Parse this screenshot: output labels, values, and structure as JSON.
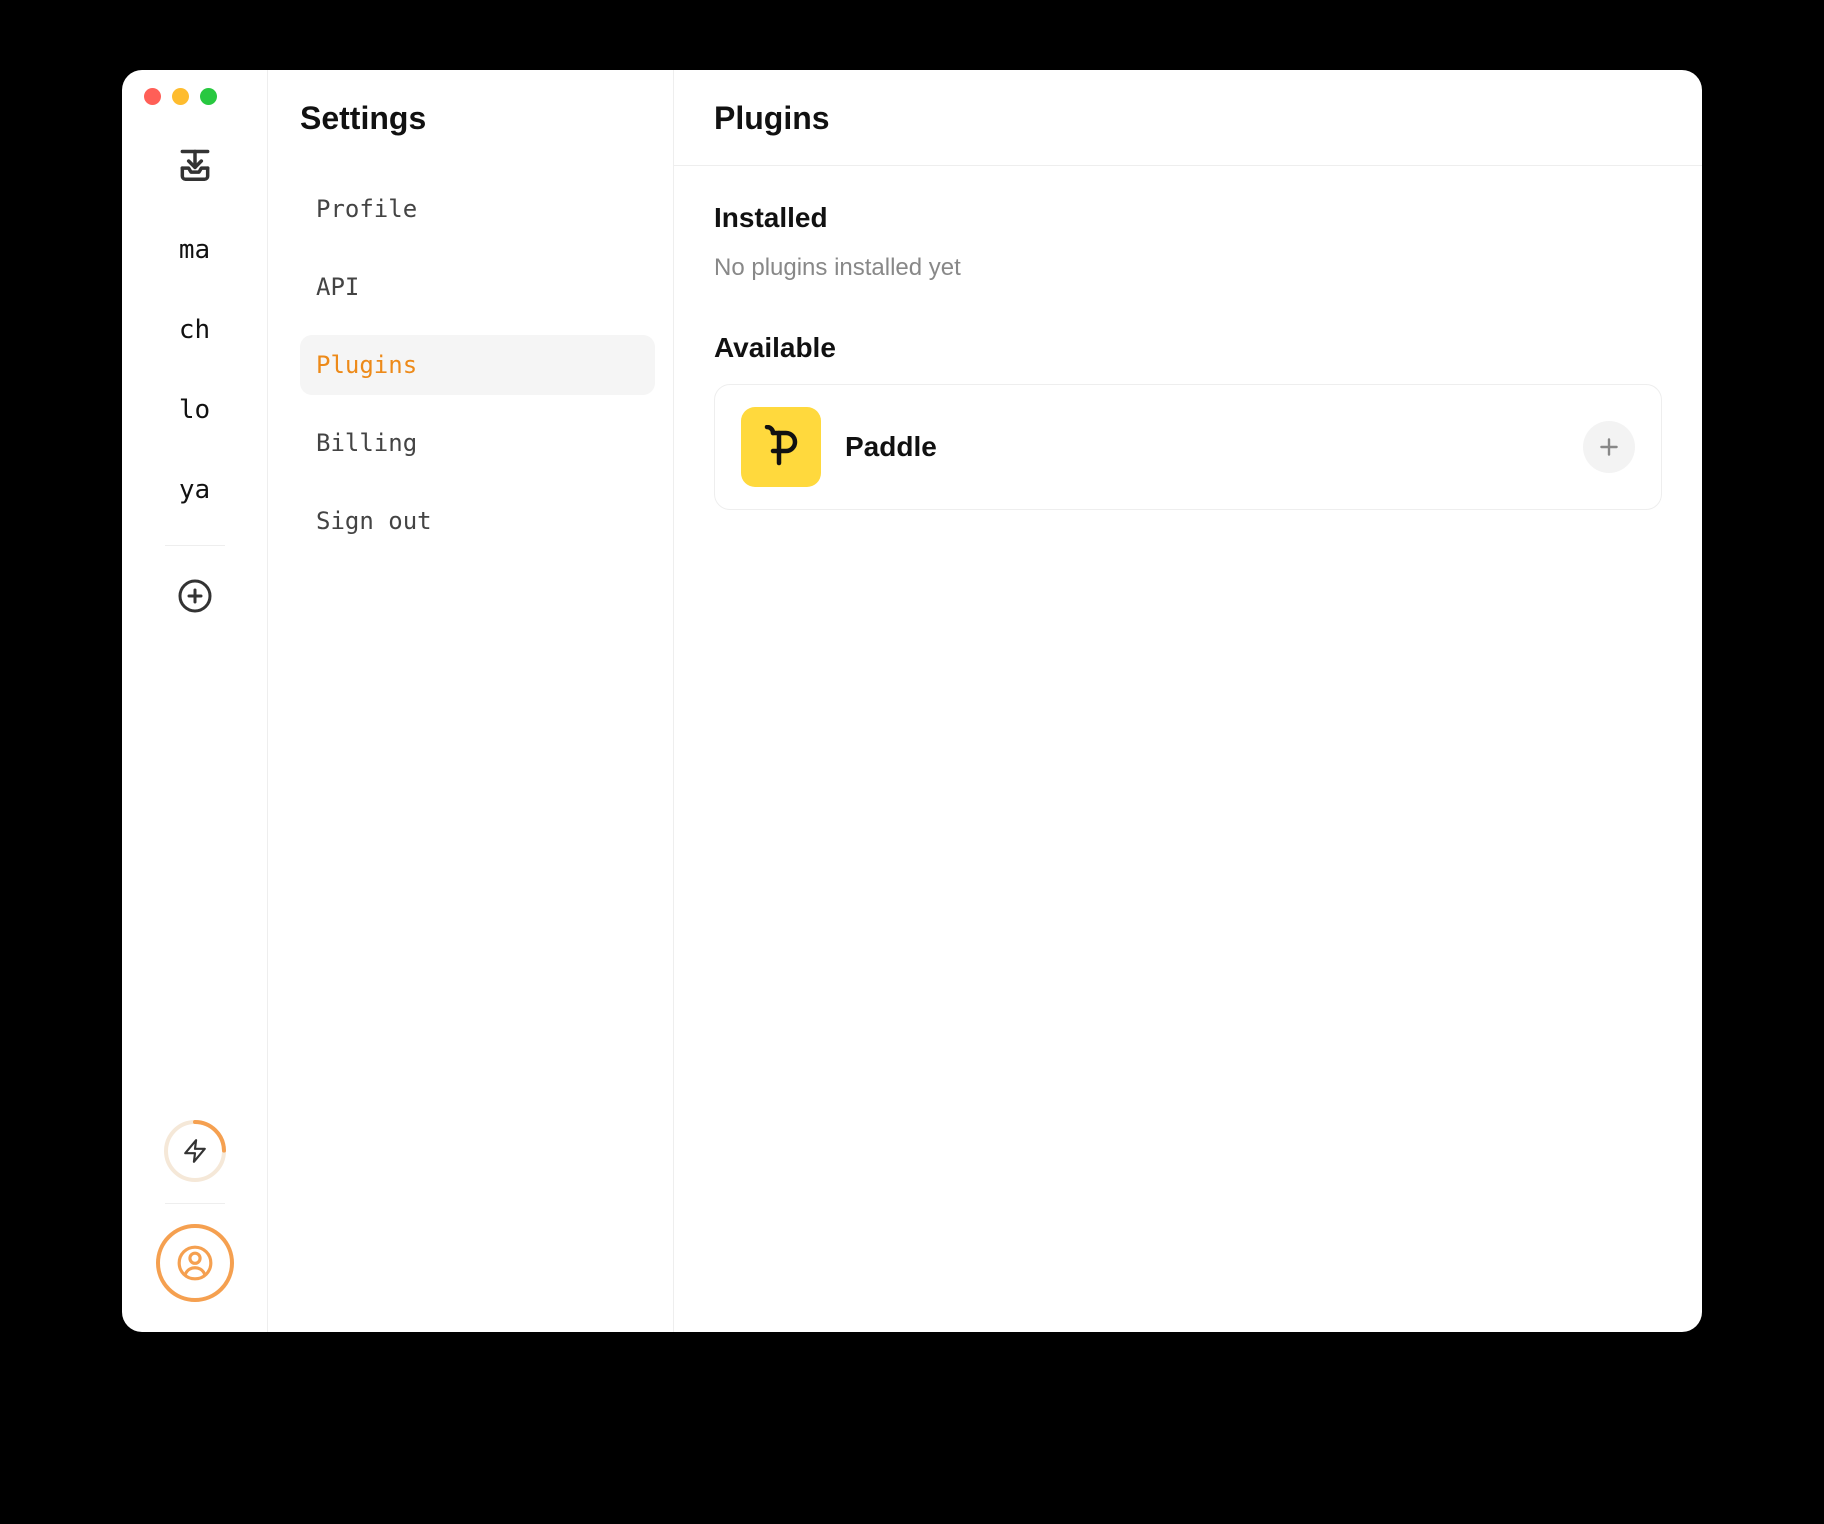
{
  "rail": {
    "items": [
      "ma",
      "ch",
      "lo",
      "ya"
    ]
  },
  "settings": {
    "title": "Settings",
    "nav": [
      {
        "label": "Profile",
        "active": false
      },
      {
        "label": "API",
        "active": false
      },
      {
        "label": "Plugins",
        "active": true
      },
      {
        "label": "Billing",
        "active": false
      },
      {
        "label": "Sign out",
        "active": false
      }
    ]
  },
  "main": {
    "title": "Plugins",
    "installed": {
      "title": "Installed",
      "empty_text": "No plugins installed yet"
    },
    "available": {
      "title": "Available",
      "plugins": [
        {
          "name": "Paddle",
          "logo_letter": "P",
          "logo_bg": "#ffd93d"
        }
      ]
    }
  }
}
